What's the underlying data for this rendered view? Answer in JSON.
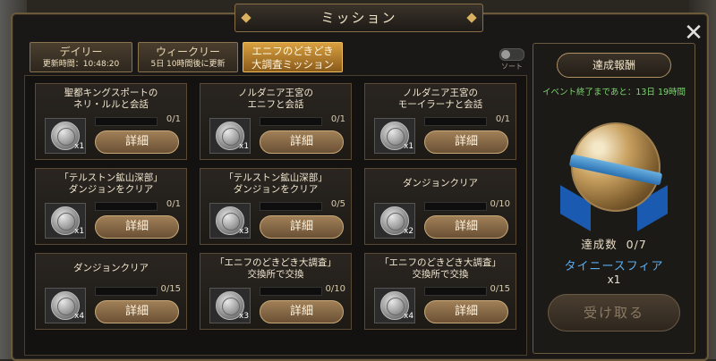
{
  "window": {
    "title": "ミッション"
  },
  "tabs": [
    {
      "label": "デイリー",
      "sub": "更新時間：10:48:20",
      "active": false
    },
    {
      "label": "ウィークリー",
      "sub": "5日 10時間後に更新",
      "active": false
    },
    {
      "label": "エニフのどきどき",
      "label2": "大調査ミッション",
      "active": true
    }
  ],
  "sort": {
    "label": "ソート",
    "on": false
  },
  "missions": [
    {
      "line1": "聖都キングスポートの",
      "line2": "ネリ・ルルと会話",
      "count": "x1",
      "progress": "0/1",
      "button": "詳細"
    },
    {
      "line1": "ノルダニア王宮の",
      "line2": "エニフと会話",
      "count": "x1",
      "progress": "0/1",
      "button": "詳細"
    },
    {
      "line1": "ノルダニア王宮の",
      "line2": "モーイラーナと会話",
      "count": "x1",
      "progress": "0/1",
      "button": "詳細"
    },
    {
      "line1": "「テルストン鉱山深部」",
      "line2": "ダンジョンをクリア",
      "count": "x1",
      "progress": "0/1",
      "button": "詳細"
    },
    {
      "line1": "「テルストン鉱山深部」",
      "line2": "ダンジョンをクリア",
      "count": "x3",
      "progress": "0/5",
      "button": "詳細"
    },
    {
      "line1": "ダンジョンクリア",
      "line2": "",
      "count": "x2",
      "progress": "0/10",
      "button": "詳細"
    },
    {
      "line1": "ダンジョンクリア",
      "line2": "",
      "count": "x4",
      "progress": "0/15",
      "button": "詳細"
    },
    {
      "line1": "「エニフのどきどき大調査」",
      "line2": "交換所で交換",
      "count": "x3",
      "progress": "0/10",
      "button": "詳細"
    },
    {
      "line1": "「エニフのどきどき大調査」",
      "line2": "交換所で交換",
      "count": "x4",
      "progress": "0/15",
      "button": "詳細"
    }
  ],
  "reward": {
    "button": "達成報酬",
    "event_end": "イベント終了まであと：13日 19時間",
    "achieved_label": "達成数",
    "achieved_value": "0/7",
    "item_name": "タイニースフィア",
    "item_qty": "x1",
    "claim_button": "受け取る"
  },
  "colors": {
    "accent": "#d8a040",
    "event_text": "#7cd870",
    "item_name": "#5aaef0"
  }
}
